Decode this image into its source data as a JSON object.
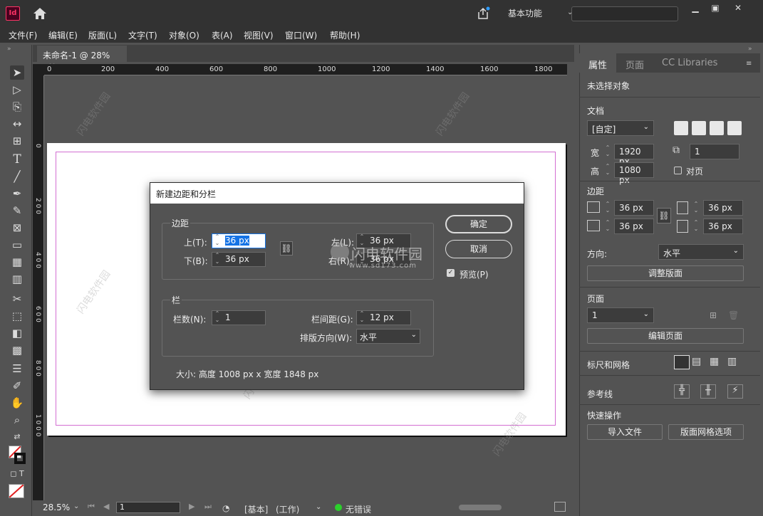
{
  "app": {
    "logo_text": "Id",
    "workspace": "基本功能"
  },
  "menu": [
    "文件(F)",
    "编辑(E)",
    "版面(L)",
    "文字(T)",
    "对象(O)",
    "表(A)",
    "视图(V)",
    "窗口(W)",
    "帮助(H)"
  ],
  "document": {
    "tab_title": "未命名-1 @ 28%",
    "close_glyph": "×"
  },
  "ruler": {
    "h_labels": [
      "0",
      "200",
      "400",
      "600",
      "800",
      "1000",
      "1200",
      "1400",
      "1600",
      "1800"
    ],
    "v_labels": [
      "0",
      "2 0 0",
      "4 0 0",
      "6 0 0",
      "8 0 0",
      "1 0 0 0"
    ]
  },
  "status": {
    "zoom": "28.5%",
    "page": "1",
    "mode": "[基本]",
    "work": "(工作)",
    "errors": "无错误"
  },
  "dialog": {
    "title": "新建边距和分栏",
    "margins_label": "边距",
    "top_label": "上(T):",
    "top_value": "36 px",
    "bottom_label": "下(B):",
    "bottom_value": "36 px",
    "left_label": "左(L):",
    "left_value": "36 px",
    "right_label": "右(R):",
    "right_value": "36 px",
    "columns_label": "栏",
    "count_label": "栏数(N):",
    "count_value": "1",
    "gutter_label": "栏间距(G):",
    "gutter_value": "12 px",
    "direction_label": "排版方向(W):",
    "direction_value": "水平",
    "size_text": "大小: 高度 1008 px x 宽度 1848 px",
    "ok": "确定",
    "cancel": "取消",
    "preview": "预览(P)"
  },
  "panel": {
    "tabs": [
      "属性",
      "页面",
      "CC Libraries"
    ],
    "no_selection": "未选择对象",
    "document_label": "文档",
    "preset": "[自定]",
    "width_label": "宽",
    "width_value": "1920 px",
    "height_label": "高",
    "height_value": "1080 px",
    "pages_value": "1",
    "facing_pages": "对页",
    "margins_label": "边距",
    "margin_top": "36 px",
    "margin_bottom": "36 px",
    "margin_left": "36 px",
    "margin_right": "36 px",
    "orientation_label": "方向:",
    "orientation_value": "水平",
    "adjust_layout": "调整版面",
    "page_label": "页面",
    "page_value": "1",
    "edit_page": "编辑页面",
    "rulers_grids": "标尺和网格",
    "guides": "参考线",
    "quick_actions": "快速操作",
    "import_file": "导入文件",
    "layout_grid": "版面网格选项"
  },
  "watermark": {
    "text": "闪电软件园",
    "site": "www.sd173.com"
  }
}
